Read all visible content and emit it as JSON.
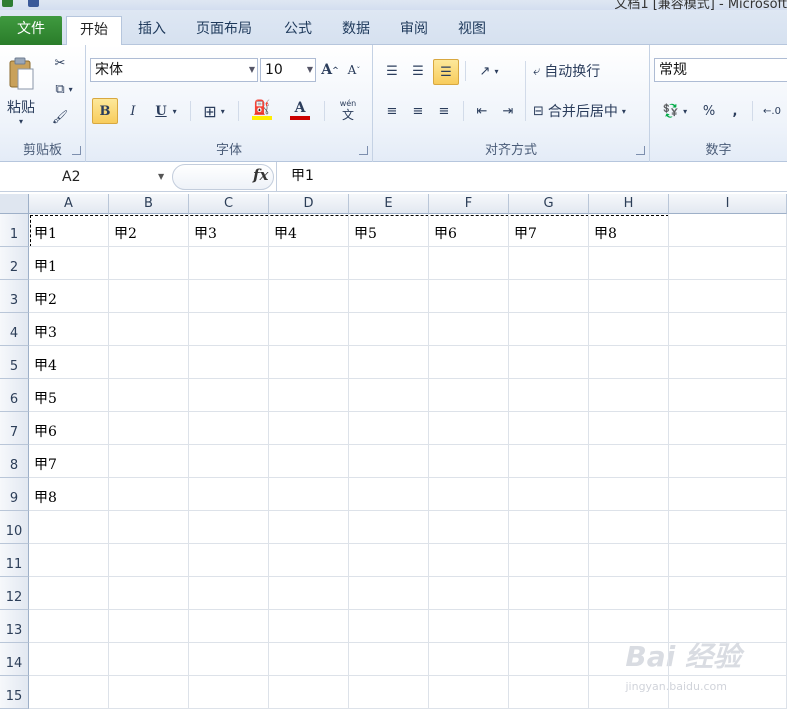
{
  "window": {
    "title": "文档1 [兼容模式] - Microsoft"
  },
  "tabs": [
    {
      "id": "file",
      "label": "文件"
    },
    {
      "id": "home",
      "label": "开始"
    },
    {
      "id": "insert",
      "label": "插入"
    },
    {
      "id": "layout",
      "label": "页面布局"
    },
    {
      "id": "formulas",
      "label": "公式"
    },
    {
      "id": "data",
      "label": "数据"
    },
    {
      "id": "review",
      "label": "审阅"
    },
    {
      "id": "view",
      "label": "视图"
    }
  ],
  "ribbon": {
    "clipboard": {
      "label": "剪贴板",
      "paste_label": "粘贴"
    },
    "font": {
      "label": "字体",
      "font_name": "宋体",
      "font_size": "10",
      "bold": "B",
      "italic": "I",
      "underline": "U",
      "grow": "A",
      "shrink": "A",
      "font_color_glyph": "A",
      "phonetic": "wén"
    },
    "alignment": {
      "label": "对齐方式",
      "wrap_text": "自动换行",
      "merge_center": "合并后居中"
    },
    "number": {
      "label": "数字",
      "format": "常规",
      "percent": "%",
      "comma": ","
    }
  },
  "formula_bar": {
    "name_box": "A2",
    "fx": "fx",
    "content": "甲1"
  },
  "grid": {
    "columns": [
      "A",
      "B",
      "C",
      "D",
      "E",
      "F",
      "G",
      "H",
      "I"
    ],
    "rows": [
      "1",
      "2",
      "3",
      "4",
      "5",
      "6",
      "7",
      "8",
      "9",
      "10",
      "11",
      "12",
      "13",
      "14",
      "15"
    ],
    "cells": {
      "A1": "甲1",
      "B1": "甲2",
      "C1": "甲3",
      "D1": "甲4",
      "E1": "甲5",
      "F1": "甲6",
      "G1": "甲7",
      "H1": "甲8",
      "A2": "甲1",
      "A3": "甲2",
      "A4": "甲3",
      "A5": "甲4",
      "A6": "甲5",
      "A7": "甲6",
      "A8": "甲7",
      "A9": "甲8"
    }
  },
  "colors": {
    "file_tab": "#2a7d2a",
    "toggled_button": "#f8cc5c",
    "font_color": "#cc0000",
    "fill_color": "#ffee00"
  },
  "watermark": {
    "text": "Bai 经验",
    "sub": "jingyan.baidu.com"
  }
}
